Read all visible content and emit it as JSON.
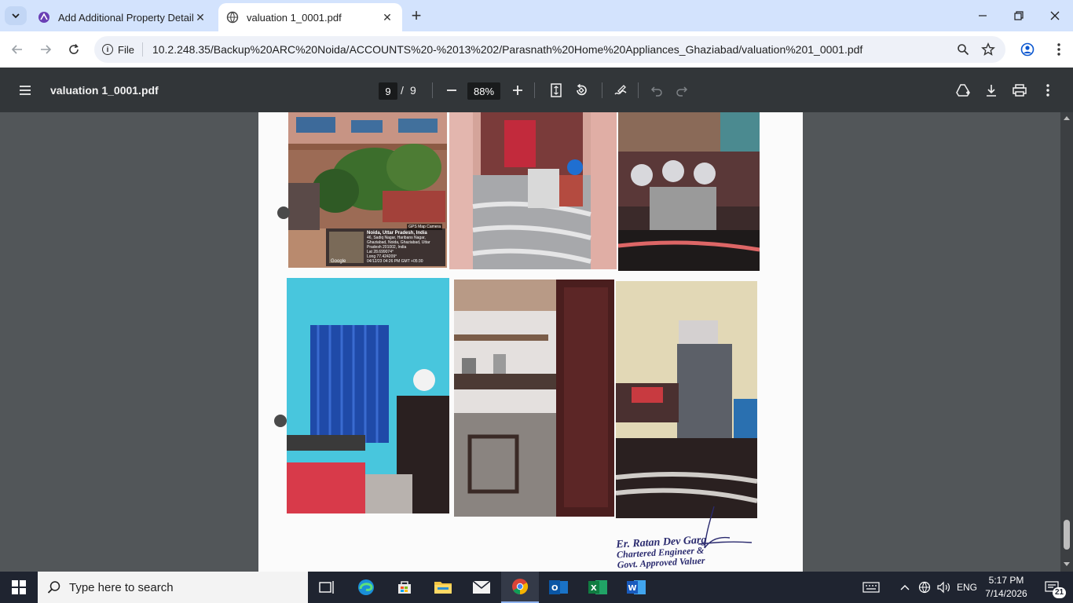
{
  "browser": {
    "tabs": [
      {
        "title": "Add Additional Property Detail",
        "active": false
      },
      {
        "title": "valuation 1_0001.pdf",
        "active": true
      }
    ],
    "address": {
      "scheme_label": "File",
      "url": "10.2.248.35/Backup%20ARC%20Noida/ACCOUNTS%20-%2013%202/Parasnath%20Home%20Appliances_Ghaziabad/valuation%201_0001.pdf"
    }
  },
  "pdf": {
    "title": "valuation 1_0001.pdf",
    "current_page": "9",
    "page_separator": "/",
    "total_pages": "9",
    "zoom": "88%"
  },
  "document": {
    "gps_overlay": {
      "brand": "GPS Map Camera",
      "place": "Noida, Uttar Pradesh, India",
      "address": "46, Sadiq Nagar, Haribans Nagar, Ghaziabad, Noida, Ghaziabad, Uttar Pradesh 201002, India",
      "lat": "Lat 28.699074°",
      "long": "Long 77.424209°",
      "datetime": "04/12/23 04:26 PM GMT +05:30",
      "map_label": "Google"
    },
    "stamp": {
      "line1": "Er. Ratan Dev Garg",
      "line2": "Chartered Engineer &",
      "line3": "Govt. Approved Valuer"
    }
  },
  "taskbar": {
    "search_placeholder": "Type here to search",
    "language": "ENG",
    "time": "5:17 PM",
    "date": "7/14/2026",
    "notification_count": "21"
  },
  "colors": {
    "tabstrip": "#d3e3fd",
    "pdf_toolbar": "#323639",
    "viewer_bg": "#525659",
    "taskbar": "#1f2430"
  }
}
